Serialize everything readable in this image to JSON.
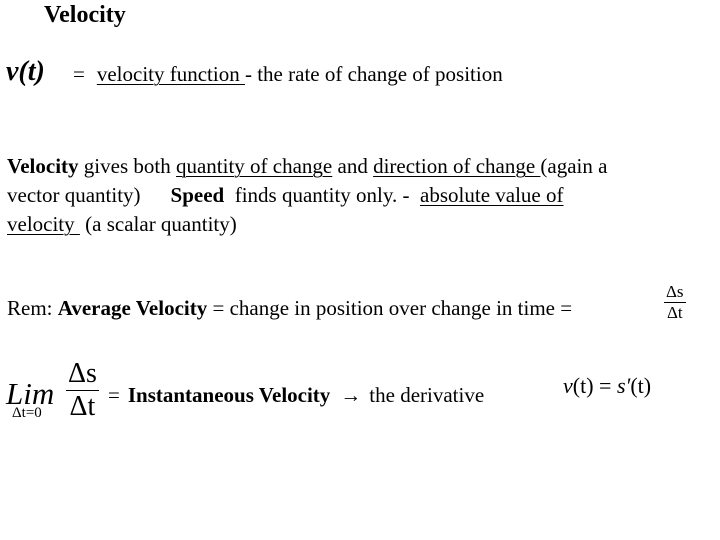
{
  "slide": {
    "title": "Velocity",
    "definition": {
      "symbol": "v(t)",
      "equals": "=",
      "term": "velocity function ",
      "description": "- the rate of change of position"
    },
    "paragraph": {
      "line1": {
        "bold_lead": "Velocity",
        "text1": " gives both ",
        "u1": "quantity of change",
        "text2": " and ",
        "u2": "direction of change ",
        "text3": "(again a"
      },
      "line2": {
        "text1": "vector quantity)",
        "bold_speed": "Speed",
        "text2": "  finds quantity only. -  ",
        "u1": "absolute value of"
      },
      "line3": {
        "u1": "velocity ",
        "text1": " (a scalar quantity)"
      }
    },
    "remark": {
      "prefix": "Rem: ",
      "bold_term": "Average Velocity",
      "text": " = change in position over change in time =",
      "fraction": {
        "numerator": "Δs",
        "denominator": "Δt"
      }
    },
    "limit": {
      "operator": "Lim",
      "subscript": "Δt=0",
      "fraction": {
        "numerator": "Δs",
        "denominator": "Δt"
      },
      "equals": "=",
      "bold_term": "Instantaneous Velocity",
      "arrow": "→",
      "text": "the derivative",
      "equation": {
        "lhs_fn": "v",
        "lhs_arg": "(t)",
        "eq": " = ",
        "rhs_fn": "s′",
        "rhs_arg": "(t)"
      }
    }
  }
}
